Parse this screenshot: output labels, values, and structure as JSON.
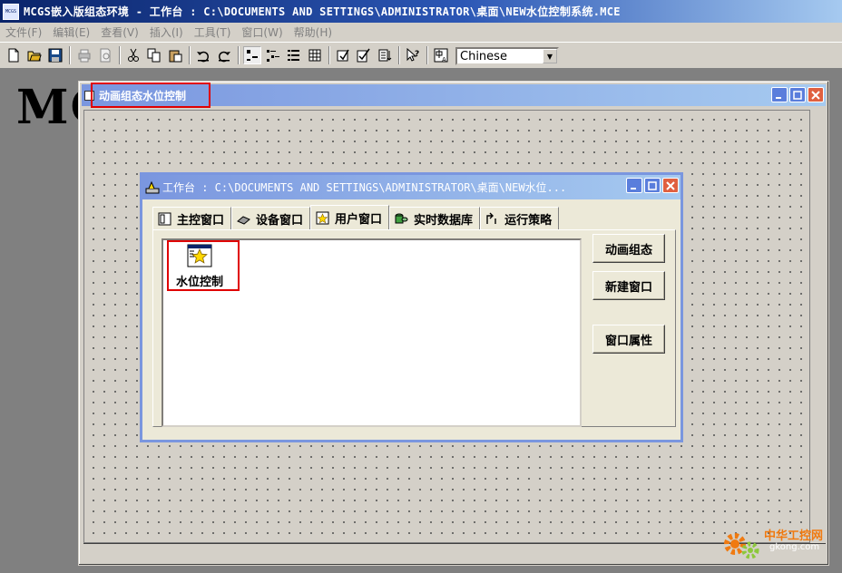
{
  "app": {
    "logo_text": "MCGS",
    "title": "MCGS嵌入版组态环境 - 工作台 : C:\\DOCUMENTS AND SETTINGS\\ADMINISTRATOR\\桌面\\NEW水位控制系统.MCE"
  },
  "menu": {
    "items": [
      "文件(F)",
      "编辑(E)",
      "查看(V)",
      "插入(I)",
      "工具(T)",
      "窗口(W)",
      "帮助(H)"
    ]
  },
  "toolbar": {
    "language_value": "Chinese"
  },
  "background": {
    "big_text": "MCGS嵌入版组态软件"
  },
  "anim_window": {
    "title": "动画组态水位控制"
  },
  "workbench": {
    "title": "工作台 : C:\\DOCUMENTS AND SETTINGS\\ADMINISTRATOR\\桌面\\NEW水位...",
    "tabs": [
      "主控窗口",
      "设备窗口",
      "用户窗口",
      "实时数据库",
      "运行策略"
    ],
    "active_tab": "用户窗口",
    "list_items": [
      "水位控制"
    ],
    "buttons": {
      "animate": "动画组态",
      "new_window": "新建窗口",
      "properties": "窗口属性"
    }
  },
  "watermark": {
    "line1": "中华工控网",
    "line2": "gkong.com"
  },
  "colors": {
    "titlebar_active": "#0a246a",
    "titlebar_inactive": "#7a96df",
    "highlight_box": "#e00000",
    "face": "#d4d0c8"
  }
}
